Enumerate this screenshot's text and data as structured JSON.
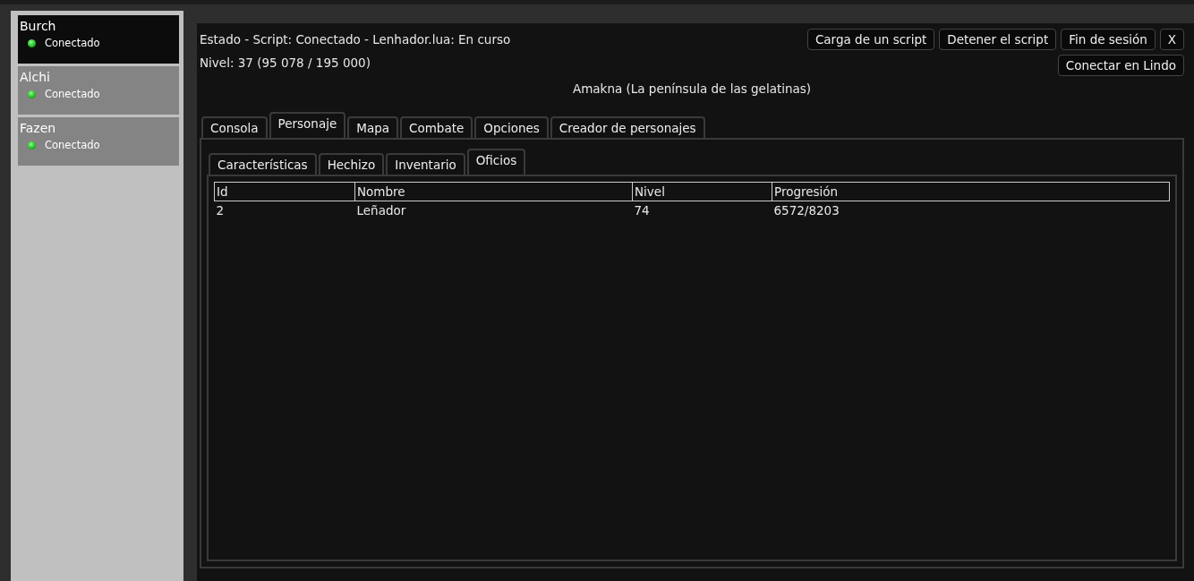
{
  "accounts": [
    {
      "name": "Burch",
      "status": "Conectado",
      "selected": true
    },
    {
      "name": "Alchi",
      "status": "Conectado",
      "selected": false
    },
    {
      "name": "Fazen",
      "status": "Conectado",
      "selected": false
    }
  ],
  "status_line": "Estado - Script: Conectado - Lenhador.lua: En curso",
  "level_line": "Nivel: 37 (95 078 / 195 000)",
  "location": "Amakna (La península de las gelatinas)",
  "buttons": [
    "Carga de un script",
    "Detener el script",
    "Fin de sesión",
    "X"
  ],
  "connect_button": "Conectar en Lindo",
  "tabs": [
    {
      "label": "Consola",
      "selected": false
    },
    {
      "label": "Personaje",
      "selected": true
    },
    {
      "label": "Mapa",
      "selected": false
    },
    {
      "label": "Combate",
      "selected": false
    },
    {
      "label": "Opciones",
      "selected": false
    },
    {
      "label": "Creador de personajes",
      "selected": false
    }
  ],
  "subtabs": [
    {
      "label": "Características",
      "selected": false
    },
    {
      "label": "Hechizo",
      "selected": false
    },
    {
      "label": "Inventario",
      "selected": false
    },
    {
      "label": "Oficios",
      "selected": true
    }
  ],
  "table": {
    "columns": [
      "Id",
      "Nombre",
      "Nivel",
      "Progresión"
    ],
    "rows": [
      [
        "2",
        "Leñador",
        "74",
        "6572/8203"
      ]
    ]
  }
}
